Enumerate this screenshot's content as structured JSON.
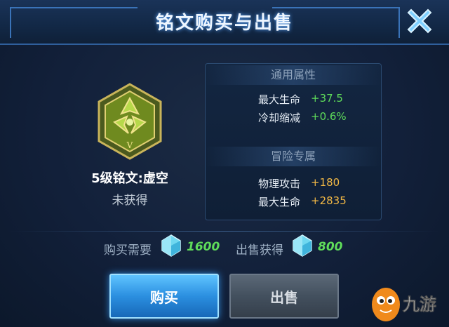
{
  "header": {
    "title": "铭文购买与出售"
  },
  "rune": {
    "name": "5级铭文:虚空",
    "status": "未获得",
    "tier_mark": "V"
  },
  "stats": {
    "common": {
      "title": "通用属性",
      "rows": [
        {
          "label": "最大生命",
          "value": "+37.5"
        },
        {
          "label": "冷却缩减",
          "value": "+0.6%"
        }
      ]
    },
    "adventure": {
      "title": "冒险专属",
      "rows": [
        {
          "label": "物理攻击",
          "value": "+180"
        },
        {
          "label": "最大生命",
          "value": "+2835"
        }
      ]
    }
  },
  "prices": {
    "buy_label": "购买需要",
    "buy_value": "1600",
    "sell_label": "出售获得",
    "sell_value": "800"
  },
  "buttons": {
    "buy": "购买",
    "sell": "出售"
  },
  "watermark": {
    "text": "九游"
  },
  "colors": {
    "green": "#5fdc5a",
    "orange": "#f2b845",
    "accent": "#2b8fe0"
  }
}
